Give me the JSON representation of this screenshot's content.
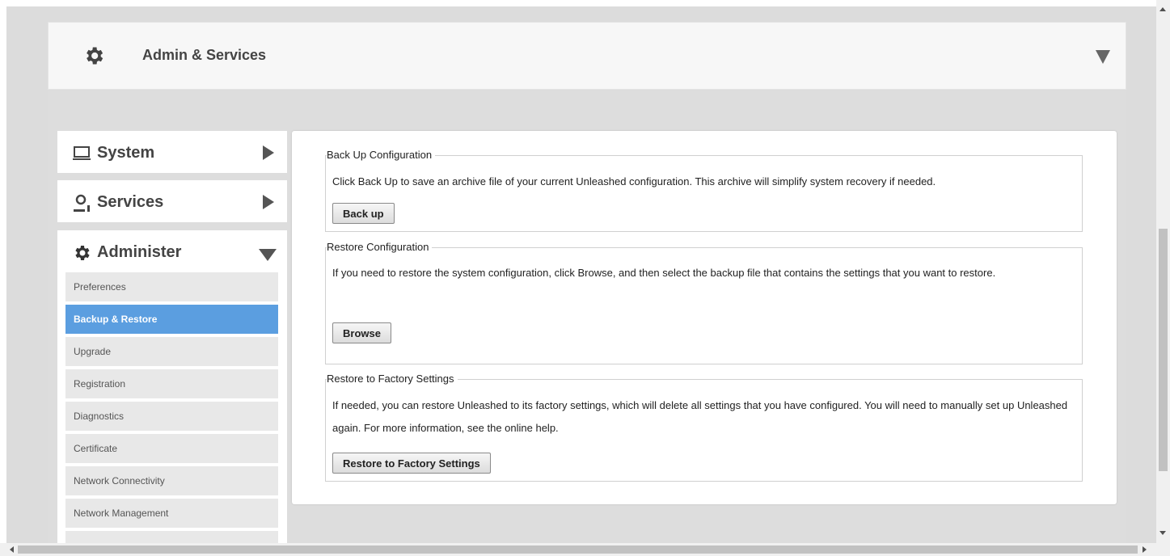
{
  "header": {
    "title": "Admin & Services",
    "icon": "gear-icon"
  },
  "nav": {
    "system": {
      "label": "System",
      "icon": "laptop-icon"
    },
    "services": {
      "label": "Services",
      "icon": "services-icon"
    },
    "administer": {
      "label": "Administer",
      "icon": "gear-icon",
      "items": [
        {
          "label": "Preferences"
        },
        {
          "label": "Backup & Restore",
          "active": true
        },
        {
          "label": "Upgrade"
        },
        {
          "label": "Registration"
        },
        {
          "label": "Diagnostics"
        },
        {
          "label": "Certificate"
        },
        {
          "label": "Network Connectivity"
        },
        {
          "label": "Network Management"
        }
      ]
    }
  },
  "sections": {
    "backup": {
      "legend": "Back Up Configuration",
      "description": "Click Back Up to save an archive file of your current Unleashed configuration. This archive will simplify system recovery if needed.",
      "button": "Back up"
    },
    "restore": {
      "legend": "Restore Configuration",
      "description": "If you need to restore the system configuration, click Browse, and then select the backup file that contains the settings that you want to restore.",
      "button": "Browse"
    },
    "factory": {
      "legend": "Restore to Factory Settings",
      "description": "If needed, you can restore Unleashed to its factory settings, which will delete all settings that you have configured. You will need to manually set up Unleashed again. For more information, see the online help.",
      "button": "Restore to Factory Settings"
    }
  },
  "colors": {
    "active_item": "#5b9ee0",
    "background": "#d9d9d9"
  }
}
